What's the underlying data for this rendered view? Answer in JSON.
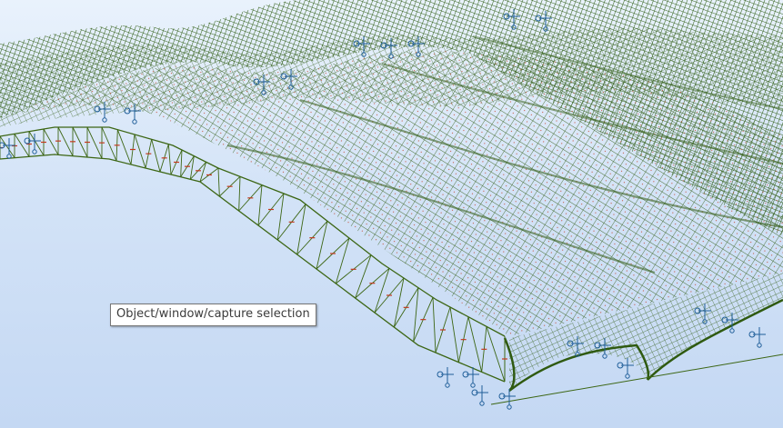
{
  "viewport": {
    "background_top": "#e9f2fc",
    "background_bottom": "#c4d8f3",
    "mesh_color": "#2f5a10",
    "node_color": "#c23a1e",
    "support_color": "#1f5e99",
    "truss_color": "#3c6614"
  },
  "tooltip": {
    "text": "Object/window/capture selection"
  }
}
